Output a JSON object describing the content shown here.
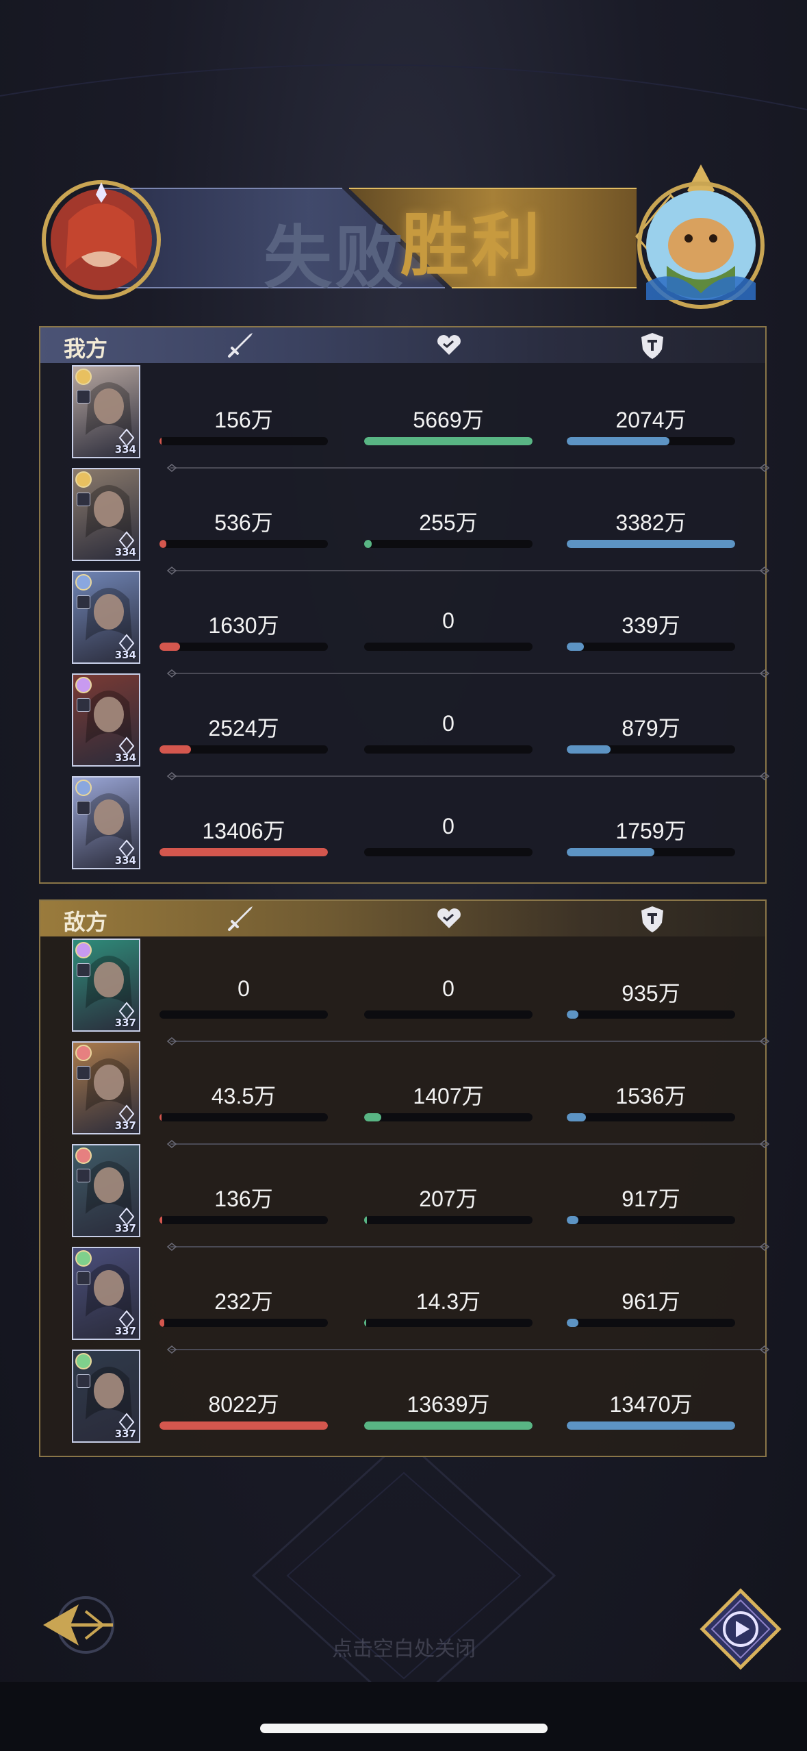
{
  "banner": {
    "lose_text": "失败",
    "win_text": "胜利"
  },
  "colors": {
    "attack": "#d4574e",
    "heal": "#59b584",
    "defense": "#5d94c4",
    "panel_border": "#8a7648"
  },
  "teams": [
    {
      "key": "ours",
      "label": "我方",
      "heroes": [
        {
          "level": "334",
          "bg": "#b7a7a0",
          "badge": "#e8c060",
          "attack": {
            "text": "156万",
            "ratio": 0.012
          },
          "heal": {
            "text": "5669万",
            "ratio": 1.0
          },
          "defense": {
            "text": "2074万",
            "ratio": 0.61
          }
        },
        {
          "level": "334",
          "bg": "#8a7a6c",
          "badge": "#e8c060",
          "attack": {
            "text": "536万",
            "ratio": 0.04
          },
          "heal": {
            "text": "255万",
            "ratio": 0.045
          },
          "defense": {
            "text": "3382万",
            "ratio": 1.0
          }
        },
        {
          "level": "334",
          "bg": "#6f84b4",
          "badge": "#8aa7df",
          "attack": {
            "text": "1630万",
            "ratio": 0.122
          },
          "heal": {
            "text": "0",
            "ratio": 0
          },
          "defense": {
            "text": "339万",
            "ratio": 0.1
          }
        },
        {
          "level": "334",
          "bg": "#7a3a34",
          "badge": "#c89af0",
          "attack": {
            "text": "2524万",
            "ratio": 0.188
          },
          "heal": {
            "text": "0",
            "ratio": 0
          },
          "defense": {
            "text": "879万",
            "ratio": 0.26
          }
        },
        {
          "level": "334",
          "bg": "#9aa6d6",
          "badge": "#8aa7df",
          "attack": {
            "text": "13406万",
            "ratio": 1.0
          },
          "heal": {
            "text": "0",
            "ratio": 0
          },
          "defense": {
            "text": "1759万",
            "ratio": 0.52
          }
        }
      ]
    },
    {
      "key": "enemy",
      "label": "敌方",
      "heroes": [
        {
          "level": "337",
          "bg": "#2f8c7a",
          "badge": "#c89af0",
          "attack": {
            "text": "0",
            "ratio": 0
          },
          "heal": {
            "text": "0",
            "ratio": 0
          },
          "defense": {
            "text": "935万",
            "ratio": 0.069
          }
        },
        {
          "level": "337",
          "bg": "#a97a4c",
          "badge": "#e68080",
          "attack": {
            "text": "43.5万",
            "ratio": 0.005
          },
          "heal": {
            "text": "1407万",
            "ratio": 0.103
          },
          "defense": {
            "text": "1536万",
            "ratio": 0.114
          }
        },
        {
          "level": "337",
          "bg": "#3f5a66",
          "badge": "#e68080",
          "attack": {
            "text": "136万",
            "ratio": 0.017
          },
          "heal": {
            "text": "207万",
            "ratio": 0.015
          },
          "defense": {
            "text": "917万",
            "ratio": 0.068
          }
        },
        {
          "level": "337",
          "bg": "#4a4e7a",
          "badge": "#7fd08c",
          "attack": {
            "text": "232万",
            "ratio": 0.029
          },
          "heal": {
            "text": "14.3万",
            "ratio": 0.001
          },
          "defense": {
            "text": "961万",
            "ratio": 0.071
          }
        },
        {
          "level": "337",
          "bg": "#2f3a4a",
          "badge": "#7fd08c",
          "attack": {
            "text": "8022万",
            "ratio": 1.0
          },
          "heal": {
            "text": "13639万",
            "ratio": 1.0
          },
          "defense": {
            "text": "13470万",
            "ratio": 1.0
          }
        }
      ]
    }
  ],
  "bottom": {
    "hint_text": "点击空白处关闭"
  }
}
